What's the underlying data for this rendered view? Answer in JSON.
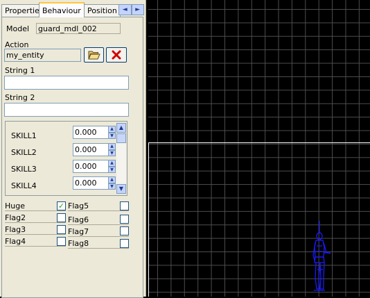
{
  "tabs": [
    {
      "label": "Properties"
    },
    {
      "label": "Behaviour"
    },
    {
      "label": "Position"
    }
  ],
  "tab_scroll": {
    "left": "◄",
    "right": "►"
  },
  "model": {
    "label": "Model",
    "value": "guard_mdl_002"
  },
  "action": {
    "label": "Action",
    "value": "my_entity",
    "open_icon": "folder-open-icon",
    "clear_icon": "red-x-icon"
  },
  "string1": {
    "label": "String 1",
    "value": ""
  },
  "string2": {
    "label": "String 2",
    "value": ""
  },
  "skills": [
    {
      "label": "SKILL1",
      "value": "0.000"
    },
    {
      "label": "SKILL2",
      "value": "0.000"
    },
    {
      "label": "SKILL3",
      "value": "0.000"
    },
    {
      "label": "SKILL4",
      "value": "0.000"
    }
  ],
  "flags_left": [
    {
      "label": "Huge",
      "checked": true
    },
    {
      "label": "Flag2",
      "checked": false
    },
    {
      "label": "Flag3",
      "checked": false
    },
    {
      "label": "Flag4",
      "checked": false
    }
  ],
  "flags_right": [
    {
      "label": "Flag5",
      "checked": false
    },
    {
      "label": "Flag6",
      "checked": false
    },
    {
      "label": "Flag7",
      "checked": false
    },
    {
      "label": "Flag8",
      "checked": false
    }
  ],
  "colors": {
    "viewport_bg": "#000000",
    "grid": "#4d4d4d",
    "model": "#1a1aff",
    "accent_tab": "#ffc83c"
  }
}
